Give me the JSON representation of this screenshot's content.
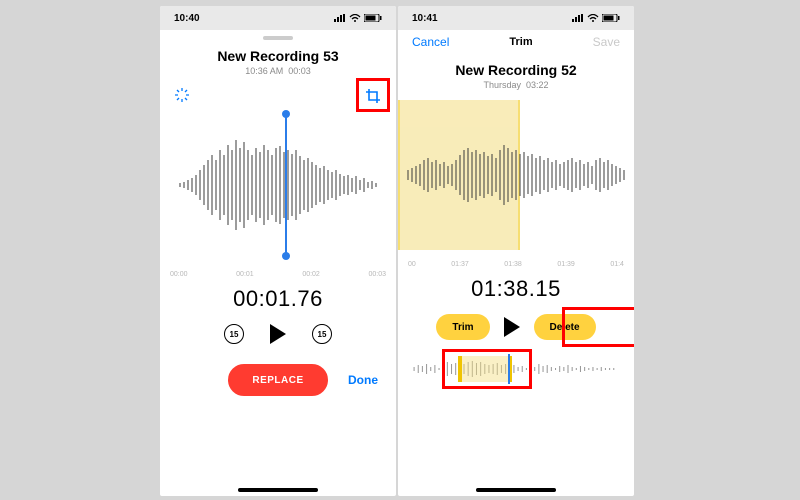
{
  "left": {
    "status_time": "10:40",
    "title": "New Recording 53",
    "subtitle_time": "10:36 AM",
    "subtitle_dur": "00:03",
    "ticks": [
      "00:00",
      "00:01",
      "00:02",
      "00:03"
    ],
    "bigtime": "00:01.76",
    "skip_back": "15",
    "skip_fwd": "15",
    "replace": "REPLACE",
    "done": "Done"
  },
  "right": {
    "status_time": "10:41",
    "cancel": "Cancel",
    "nav_title": "Trim",
    "save": "Save",
    "title": "New Recording 52",
    "subtitle_day": "Thursday",
    "subtitle_dur": "03:22",
    "ticks": [
      "00",
      "01:37",
      "01:38",
      "01:39",
      "01:4"
    ],
    "bigtime": "01:38.15",
    "trim": "Trim",
    "delete": "Delete"
  }
}
